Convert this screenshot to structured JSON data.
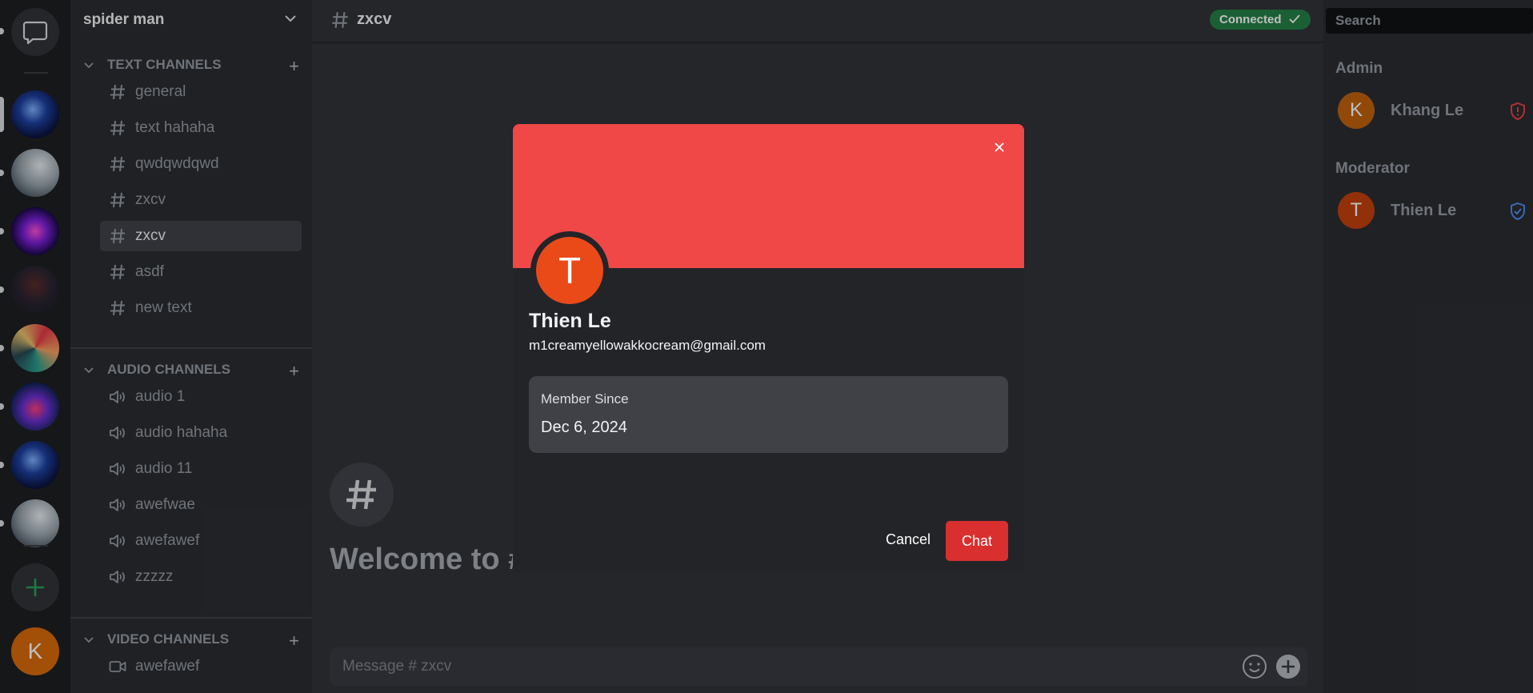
{
  "colors": {
    "accent": "#f04747",
    "chat_button": "#da2f2f",
    "connected": "#248046",
    "admin_avatar": "#c2620e",
    "moderator_avatar": "#c2410c",
    "modal_avatar": "#ea4a18",
    "user_avatar": "#d96a0a",
    "add_server": "#23a55a"
  },
  "rail": {
    "servers": [
      {
        "icon": "spider-man-avatar-icon"
      },
      {
        "icon": "moon-avatar-icon"
      },
      {
        "icon": "neon-portal-avatar-icon"
      },
      {
        "icon": "dark-figure-avatar-icon"
      },
      {
        "icon": "colorful-explosion-avatar-icon"
      },
      {
        "icon": "multiverse-avatar-icon"
      },
      {
        "icon": "spider-man-avatar-icon"
      },
      {
        "icon": "moon-avatar-icon"
      }
    ],
    "user_initial": "K"
  },
  "sidebar": {
    "server_name": "spider man",
    "text_category": "TEXT CHANNELS",
    "text_channels": [
      "general",
      "text hahaha",
      "qwdqwdqwd",
      "zxcv",
      "zxcv",
      "asdf",
      "new text"
    ],
    "audio_category": "AUDIO CHANNELS",
    "audio_channels": [
      "audio 1",
      "audio hahaha",
      "audio 11",
      "awefwae",
      "awefawef",
      "zzzzz"
    ],
    "video_category": "VIDEO CHANNELS",
    "video_channels": [
      "awefawef"
    ]
  },
  "main": {
    "channel_title": "zxcv",
    "status": "Connected",
    "welcome_text": "Welcome to #",
    "composer_placeholder": "Message # zxcv"
  },
  "members": {
    "search_placeholder": "Search",
    "admin_label": "Admin",
    "admin": {
      "initial": "K",
      "name": "Khang Le"
    },
    "moderator_label": "Moderator",
    "moderator": {
      "initial": "T",
      "name": "Thien Le"
    }
  },
  "modal": {
    "initial": "T",
    "name": "Thien Le",
    "email": "m1creamyellowakkocream@gmail.com",
    "member_since_label": "Member Since",
    "member_since_value": "Dec 6, 2024",
    "cancel_label": "Cancel",
    "chat_label": "Chat"
  }
}
